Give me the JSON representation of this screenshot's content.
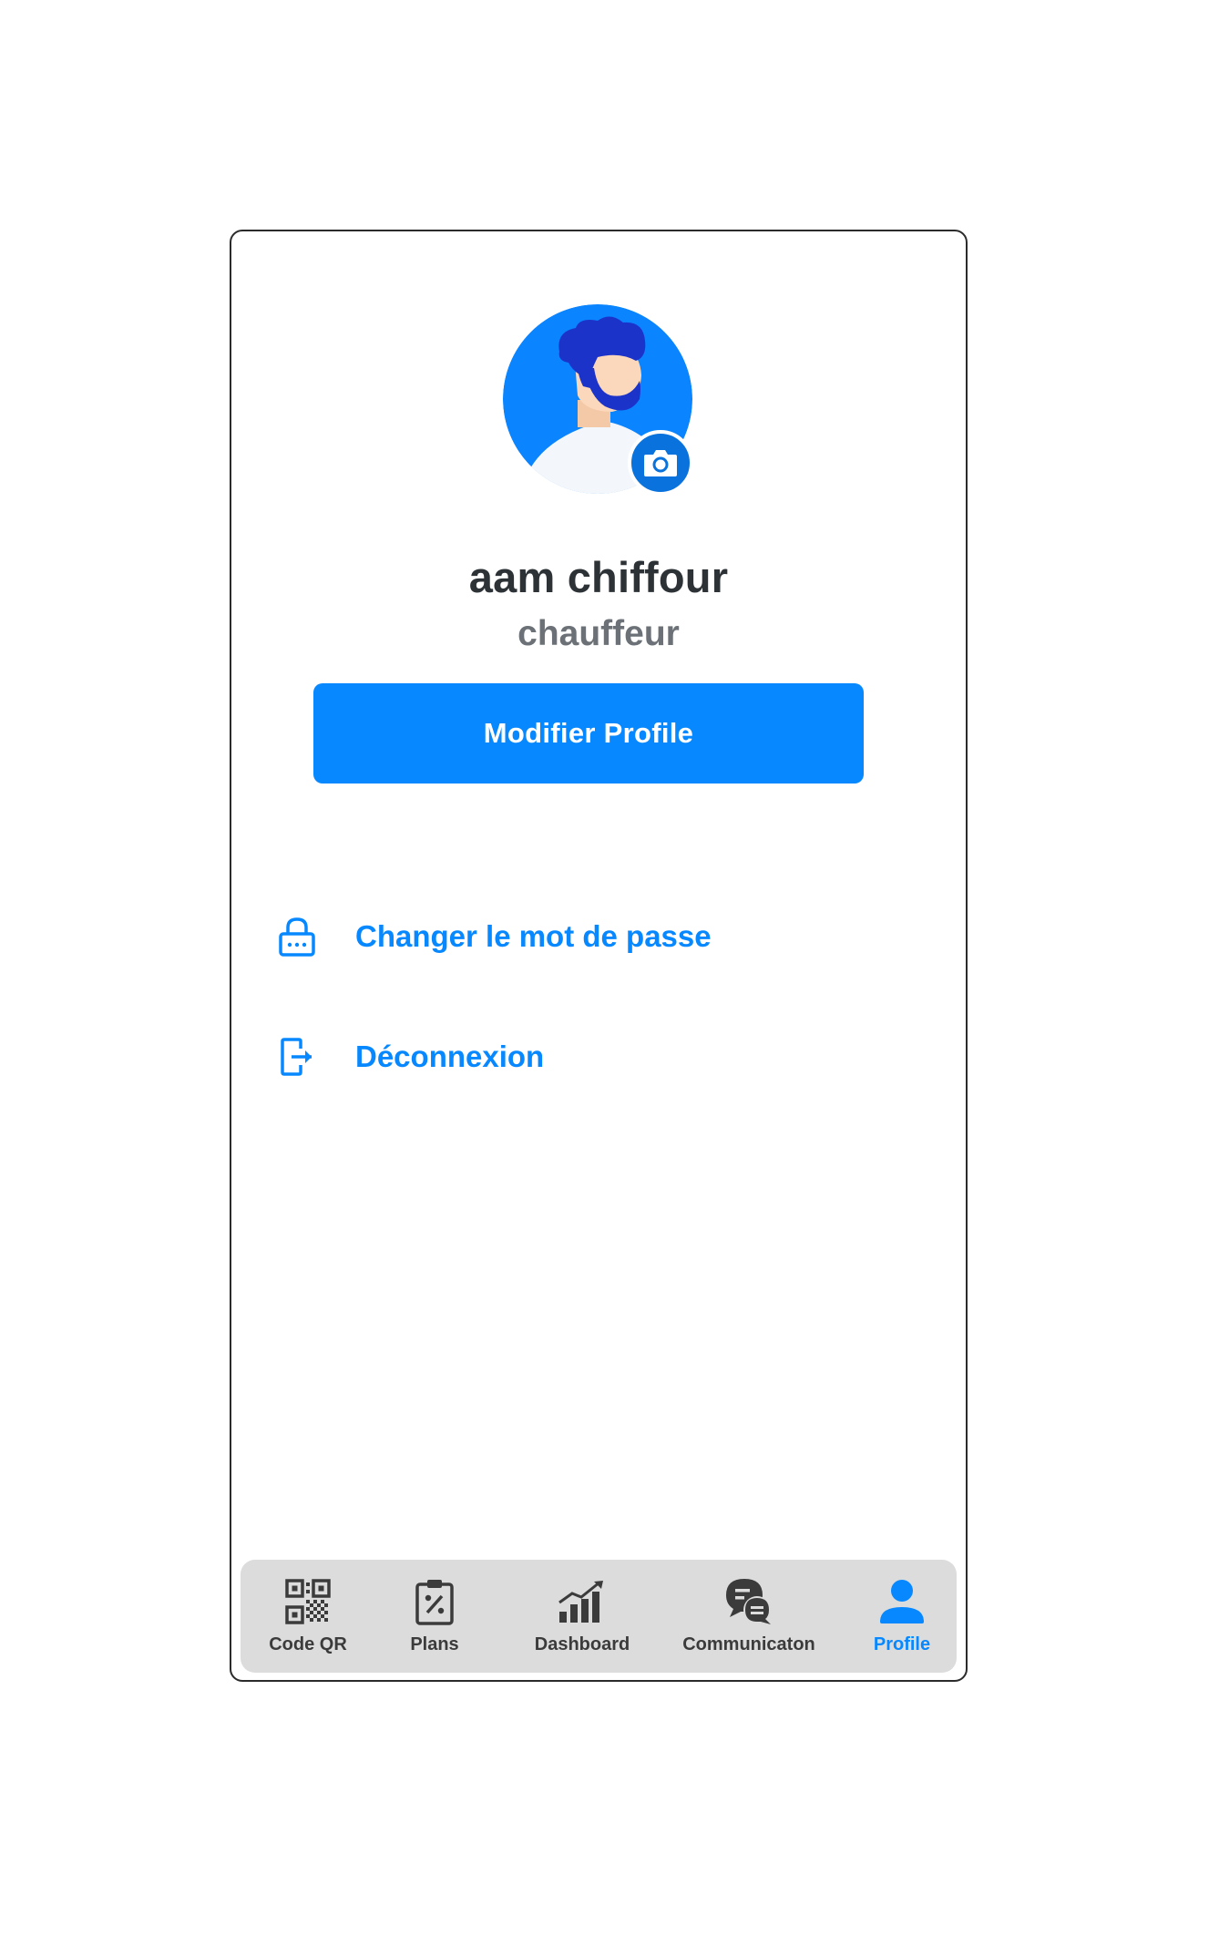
{
  "profile": {
    "name": "aam chiffour",
    "role": "chauffeur",
    "avatar_icon": "user-avatar-illustration",
    "camera_icon": "camera-icon",
    "edit_button_label": "Modifier Profile"
  },
  "menu": {
    "items": [
      {
        "label": "Changer le mot de passe",
        "icon": "lock-icon"
      },
      {
        "label": "Déconnexion",
        "icon": "logout-icon"
      }
    ]
  },
  "bottom_nav": {
    "items": [
      {
        "label": "Code QR",
        "icon": "qr-code-icon",
        "active": false
      },
      {
        "label": "Plans",
        "icon": "clipboard-icon",
        "active": false
      },
      {
        "label": "Dashboard",
        "icon": "bar-chart-icon",
        "active": false
      },
      {
        "label": "Communicaton",
        "icon": "chat-icon",
        "active": false
      },
      {
        "label": "Profile",
        "icon": "user-icon",
        "active": true
      }
    ]
  },
  "colors": {
    "accent": "#0788ff",
    "avatar_bg": "#0a84ff",
    "nav_bg": "#dcdcdc",
    "text_dark": "#2d3236",
    "text_muted": "#6b7176"
  }
}
